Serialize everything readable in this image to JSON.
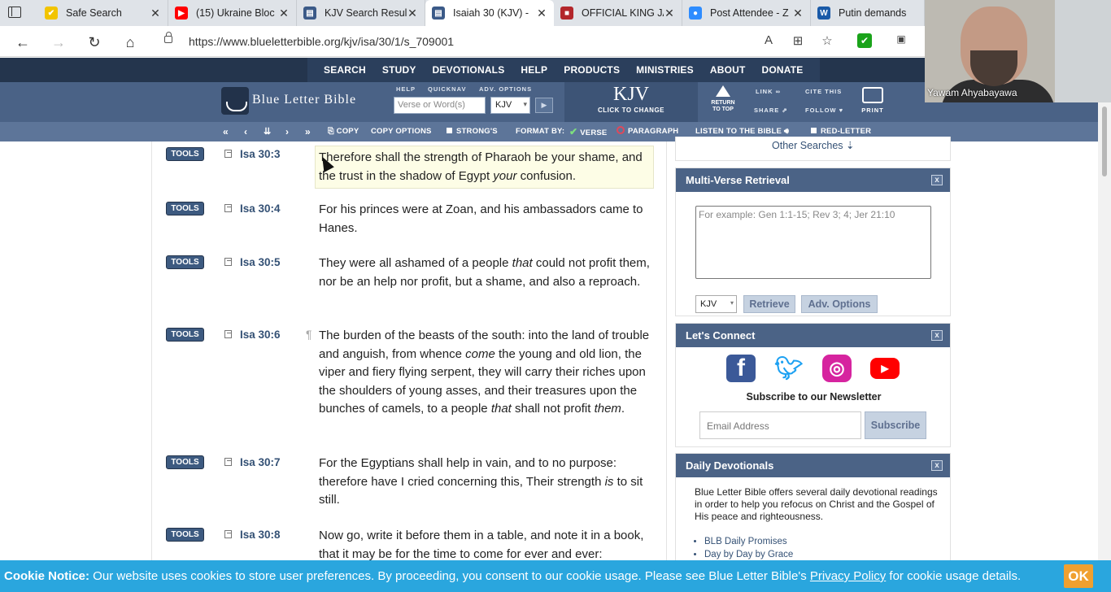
{
  "browser": {
    "tabs": [
      {
        "title": "Safe Search",
        "favicon_color": "#f2c400",
        "favicon_glyph": "✔"
      },
      {
        "title": "(15) Ukraine Bloc",
        "favicon_color": "#ff0000",
        "favicon_glyph": "▶"
      },
      {
        "title": "KJV Search Resul",
        "favicon_color": "#3b5a88",
        "favicon_glyph": "▤"
      },
      {
        "title": "Isaiah 30 (KJV) - ",
        "favicon_color": "#3b5a88",
        "favicon_glyph": "▤",
        "active": true
      },
      {
        "title": "OFFICIAL KING JA",
        "favicon_color": "#b3262b",
        "favicon_glyph": "■"
      },
      {
        "title": "Post Attendee - Z",
        "favicon_color": "#2d8cff",
        "favicon_glyph": "●"
      },
      {
        "title": "Putin demands ",
        "favicon_color": "#1a5aa8",
        "favicon_glyph": "W"
      }
    ],
    "url": "https://www.blueletterbible.org/kjv/isa/30/1/s_709001"
  },
  "site_menu": [
    "SEARCH",
    "STUDY",
    "DEVOTIONALS",
    "HELP",
    "PRODUCTS",
    "MINISTRIES",
    "ABOUT",
    "DONATE"
  ],
  "header": {
    "logo": "Blue Letter Bible",
    "cap_help": "HELP",
    "cap_quicknav": "QUICKNAV",
    "cap_adv": "ADV. OPTIONS",
    "search_placeholder": "Verse or Word(s)",
    "version": "KJV",
    "kjv_big": "KJV",
    "kjv_small": "CLICK TO CHANGE",
    "return_top_1": "RETURN",
    "return_top_2": "TO TOP",
    "link": "LINK",
    "cite": "CITE THIS",
    "share": "SHARE",
    "follow": "FOLLOW",
    "print": "PRINT"
  },
  "toolbar": {
    "copy": "COPY",
    "copy_options": "COPY OPTIONS",
    "strongs": "STRONG'S",
    "format_by": "FORMAT BY:",
    "verse": "VERSE",
    "paragraph": "PARAGRAPH",
    "listen": "LISTEN TO THE BIBLE",
    "red_letter": "RED-LETTER"
  },
  "verses": [
    {
      "tools": "TOOLS",
      "ref": "Isa 30:3",
      "para": "",
      "text_html": "Therefore shall the strength of Pharaoh be your shame, and the trust in the shadow of Egypt <i>your</i> confusion."
    },
    {
      "tools": "TOOLS",
      "ref": "Isa 30:4",
      "para": "",
      "text_html": "For his princes were at Zoan, and his ambassadors came to Hanes."
    },
    {
      "tools": "TOOLS",
      "ref": "Isa 30:5",
      "para": "",
      "text_html": "They were all ashamed of a people <i>that</i> could not profit them, nor be an help nor profit, but a shame, and also a reproach."
    },
    {
      "tools": "TOOLS",
      "ref": "Isa 30:6",
      "para": "¶",
      "text_html": "The burden of the beasts of the south: into the land of trouble and anguish, from whence <i>come</i> the young and old lion, the viper and fiery flying serpent, they will carry their riches upon the shoulders of young asses, and their treasures upon the bunches of camels, to a people <i>that</i> shall not profit <i>them</i>."
    },
    {
      "tools": "TOOLS",
      "ref": "Isa 30:7",
      "para": "",
      "text_html": "For the Egyptians shall help in vain, and to no purpose: therefore have I cried concerning this, Their strength <i>is</i> to sit still."
    },
    {
      "tools": "TOOLS",
      "ref": "Isa 30:8",
      "para": "",
      "text_html": "Now go, write it before them in a table, and note it in a book, that it may be for the time to come for ever and ever:"
    }
  ],
  "sidebar": {
    "other_searches": "Other Searches ⇣",
    "mvr_title": "Multi-Verse Retrieval",
    "mvr_placeholder": "For example: Gen 1:1-15; Rev 3; 4; Jer 21:10",
    "mvr_version": "KJV",
    "retrieve": "Retrieve",
    "adv_options": "Adv. Options",
    "connect_title": "Let's Connect",
    "newsletter": "Subscribe to our Newsletter",
    "email_placeholder": "Email Address",
    "subscribe": "Subscribe",
    "dd_title": "Daily Devotionals",
    "dd_body": "Blue Letter Bible offers several daily devotional readings in order to help you refocus on Christ and the Gospel of His peace and righteousness.",
    "dd_items": [
      "BLB Daily Promises",
      "Day by Day by Grace"
    ],
    "close": "x"
  },
  "webcam": {
    "name": "Yawam Ahyabayawa"
  },
  "cookie": {
    "label": "Cookie Notice:",
    "text": " Our website uses cookies to store user preferences. By proceeding, you consent to our cookie usage. Please see Blue Letter Bible's ",
    "link": "Privacy Policy",
    "tail": " for cookie usage details.",
    "ok": "OK"
  }
}
